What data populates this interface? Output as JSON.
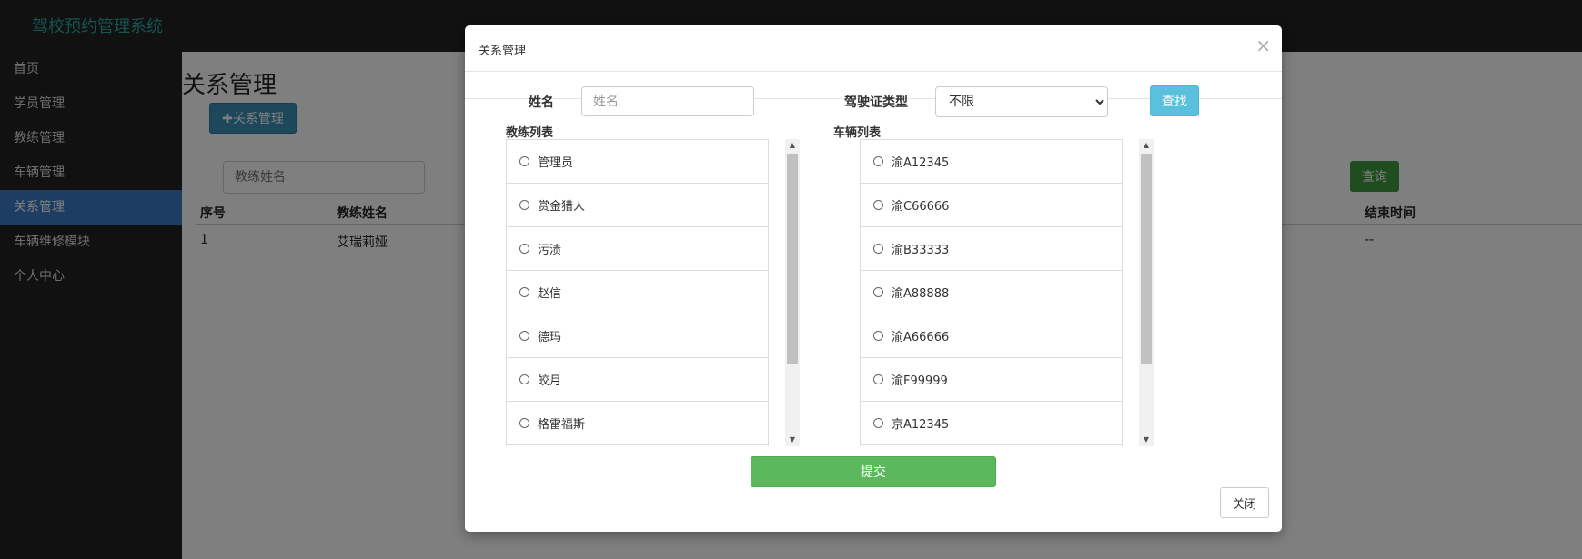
{
  "app": {
    "brand": "驾校预约管理系统"
  },
  "sidebar": {
    "items": [
      {
        "label": "首页"
      },
      {
        "label": "学员管理"
      },
      {
        "label": "教练管理"
      },
      {
        "label": "车辆管理"
      },
      {
        "label": "关系管理",
        "active": true
      },
      {
        "label": "车辆维修模块"
      },
      {
        "label": "个人中心"
      }
    ]
  },
  "page": {
    "title": "关系管理",
    "add_button": "✚关系管理",
    "search_placeholder": "教练姓名",
    "query_button": "查询",
    "table": {
      "headers": {
        "index": "序号",
        "coach_name": "教练姓名",
        "end_time": "结束时间"
      },
      "rows": [
        {
          "index": "1",
          "coach_name": "艾瑞莉娅",
          "end_time": "--"
        }
      ]
    }
  },
  "modal": {
    "title": "关系管理",
    "close_symbol": "×",
    "filters": {
      "name_label": "姓名",
      "name_placeholder": "姓名",
      "license_label": "驾驶证类型",
      "license_selected": "不限",
      "find_button": "查找"
    },
    "coach_list": {
      "label": "教练列表",
      "items": [
        "管理员",
        "赏金猎人",
        "污渍",
        "赵信",
        "德玛",
        "皎月",
        "格雷福斯"
      ]
    },
    "car_list": {
      "label": "车辆列表",
      "items": [
        "渝A12345",
        "渝C66666",
        "渝B33333",
        "渝A88888",
        "渝A66666",
        "渝F99999",
        "京A12345"
      ]
    },
    "submit_button": "提交",
    "close_button": "关闭"
  },
  "colors": {
    "nav_bg": "#222222",
    "brand": "#2ba4a4",
    "sidebar_active": "#3a7cc4",
    "submit": "#5cb85c",
    "find": "#5bc0de",
    "query": "#3e9a3e"
  }
}
